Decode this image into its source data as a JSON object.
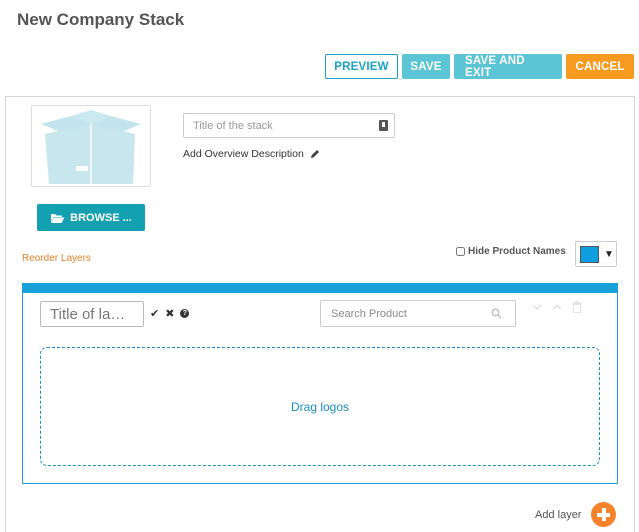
{
  "page": {
    "title": "New Company Stack"
  },
  "toolbar": {
    "preview_label": "PREVIEW",
    "save_label": "SAVE",
    "save_exit_label": "SAVE AND EXIT",
    "cancel_label": "CANCEL"
  },
  "stack": {
    "title_placeholder": "Title of the stack",
    "title_value": "",
    "add_description_label": "Add Overview Description",
    "browse_label": "BROWSE ..."
  },
  "options": {
    "reorder_label": "Reorder Layers",
    "hide_names_label": "Hide Product Names",
    "hide_names_checked": false,
    "color_value": "#0e9ee0"
  },
  "layer": {
    "title_placeholder": "Title of la…",
    "search_placeholder": "Search Product",
    "drop_label": "Drag logos",
    "accent_color": "#1ba1d9"
  },
  "footer": {
    "add_layer_label": "Add layer"
  },
  "icons": {
    "lock": "lock-icon",
    "pencil": "pencil-icon",
    "folder": "folder-open-icon",
    "check": "check-icon",
    "close": "close-icon",
    "help": "question-icon",
    "search": "search-icon",
    "down": "chevron-down-icon",
    "up": "chevron-up-icon",
    "trash": "trash-icon",
    "plus": "plus-circle-icon"
  }
}
